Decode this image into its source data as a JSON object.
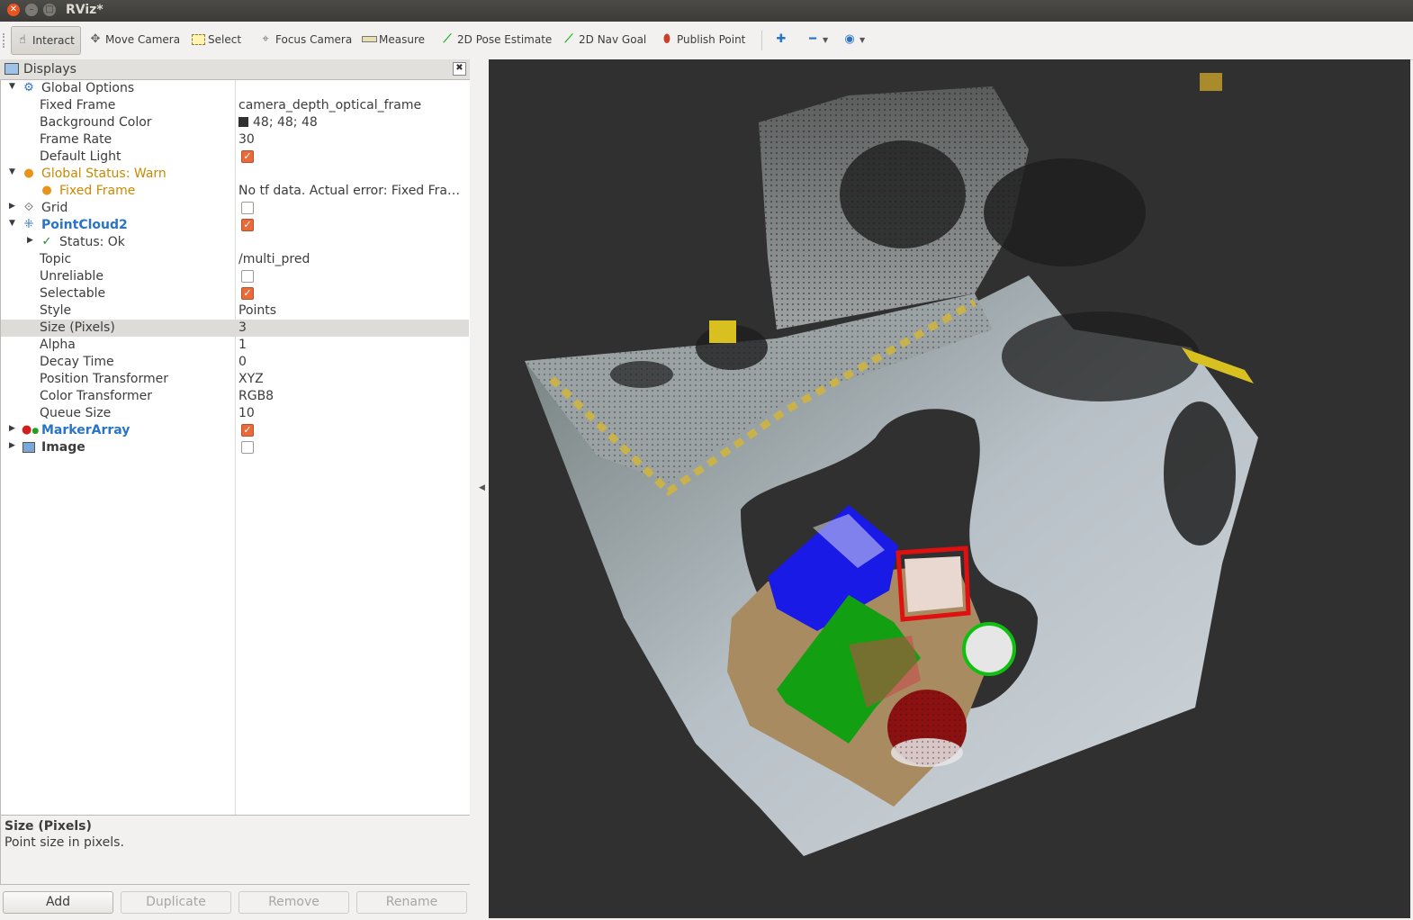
{
  "window": {
    "title": "RViz*"
  },
  "toolbar": {
    "tools": [
      {
        "label": "Interact",
        "icon": "hand-pointer-icon",
        "active": true
      },
      {
        "label": "Move Camera",
        "icon": "move-camera-icon"
      },
      {
        "label": "Select",
        "icon": "select-box-icon"
      },
      {
        "label": "Focus Camera",
        "icon": "focus-crosshair-icon"
      },
      {
        "label": "Measure",
        "icon": "ruler-icon"
      },
      {
        "label": "2D Pose Estimate",
        "icon": "green-arrow-icon"
      },
      {
        "label": "2D Nav Goal",
        "icon": "green-arrow-icon"
      },
      {
        "label": "Publish Point",
        "icon": "map-pin-icon"
      }
    ]
  },
  "displays": {
    "header": "Displays",
    "rows": [
      {
        "name": "Global Options",
        "value": ""
      },
      {
        "name": "Fixed Frame",
        "value": "camera_depth_optical_frame"
      },
      {
        "name": "Background Color",
        "value": "48; 48; 48"
      },
      {
        "name": "Frame Rate",
        "value": "30"
      },
      {
        "name": "Default Light",
        "value": ""
      },
      {
        "name": "Global Status: Warn",
        "value": ""
      },
      {
        "name": "Fixed Frame",
        "value": "No tf data.  Actual error: Fixed Fra…"
      },
      {
        "name": "Grid",
        "value": ""
      },
      {
        "name": "PointCloud2",
        "value": ""
      },
      {
        "name": "Status: Ok",
        "value": ""
      },
      {
        "name": "Topic",
        "value": "/multi_pred"
      },
      {
        "name": "Unreliable",
        "value": ""
      },
      {
        "name": "Selectable",
        "value": ""
      },
      {
        "name": "Style",
        "value": "Points"
      },
      {
        "name": "Size (Pixels)",
        "value": "3"
      },
      {
        "name": "Alpha",
        "value": "1"
      },
      {
        "name": "Decay Time",
        "value": "0"
      },
      {
        "name": "Position Transformer",
        "value": "XYZ"
      },
      {
        "name": "Color Transformer",
        "value": "RGB8"
      },
      {
        "name": "Queue Size",
        "value": "10"
      },
      {
        "name": "MarkerArray",
        "value": ""
      },
      {
        "name": "Image",
        "value": ""
      }
    ],
    "checkboxes": {
      "default_light": true,
      "grid": false,
      "pointcloud2": true,
      "unreliable": false,
      "selectable": true,
      "markerarray": true,
      "image": false
    },
    "background_color_hex": "#303030"
  },
  "description": {
    "title": "Size (Pixels)",
    "text": "Point size in pixels."
  },
  "buttons": {
    "add": "Add",
    "duplicate": "Duplicate",
    "remove": "Remove",
    "rename": "Rename"
  },
  "viewport": {
    "background": "#303030"
  }
}
